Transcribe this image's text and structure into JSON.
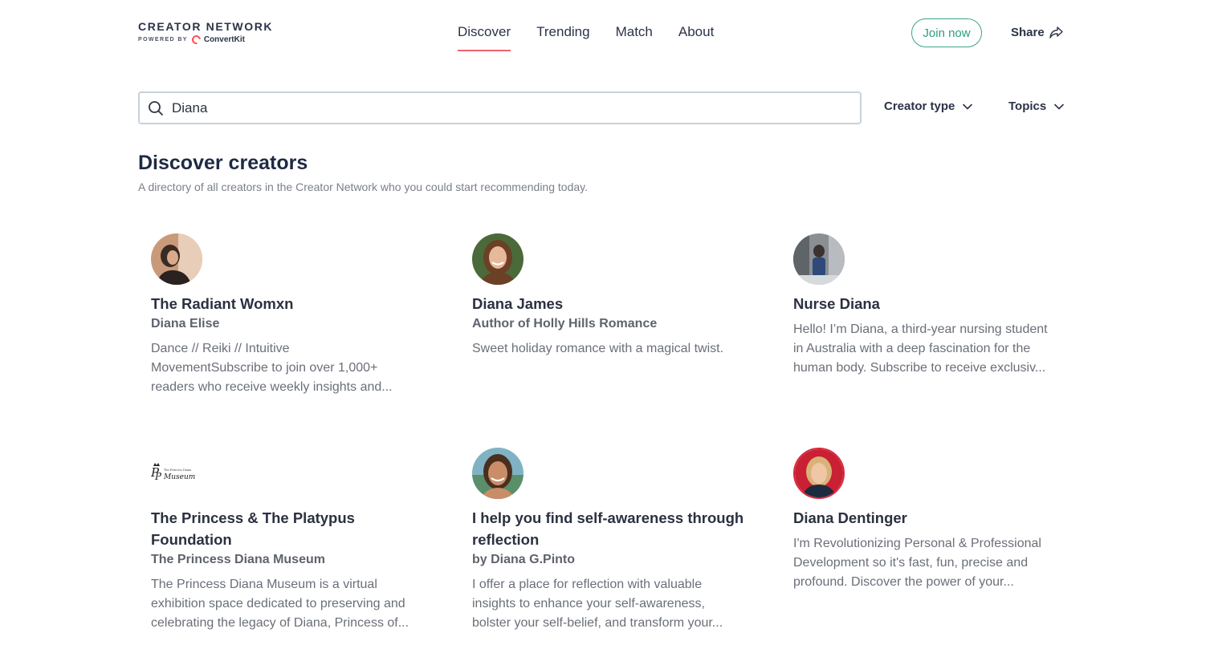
{
  "brand": {
    "title": "CREATOR NETWORK",
    "powered_by": "POWERED BY",
    "partner": "ConvertKit"
  },
  "nav": {
    "items": [
      {
        "label": "Discover",
        "active": true
      },
      {
        "label": "Trending",
        "active": false
      },
      {
        "label": "Match",
        "active": false
      },
      {
        "label": "About",
        "active": false
      }
    ]
  },
  "header": {
    "join_label": "Join now",
    "share_label": "Share"
  },
  "search": {
    "value": "Diana",
    "icon": "search-icon"
  },
  "filters": {
    "creator_type": "Creator type",
    "topics": "Topics"
  },
  "main": {
    "title": "Discover creators",
    "subtitle": "A directory of all creators in the Creator Network who you could start recommending today."
  },
  "cards": [
    {
      "title": "The Radiant Womxn",
      "subtitle": "Diana Elise",
      "description_lines": [
        "Dance // Reiki // Intuitive",
        "MovementSubscribe to join over 1,000+",
        "readers who receive weekly insights and..."
      ]
    },
    {
      "title": "Diana James",
      "subtitle": "Author of Holly Hills Romance",
      "description_lines": [
        "Sweet holiday romance with a magical twist."
      ]
    },
    {
      "title": "Nurse Diana",
      "subtitle": "",
      "description_lines": [
        "Hello! I’m Diana, a third-year nursing student",
        "in Australia with a deep fascination for the",
        "human body. Subscribe to receive exclusiv..."
      ]
    },
    {
      "title_lines": [
        "The Princess & The Platypus",
        "Foundation"
      ],
      "subtitle": "The Princess Diana Museum",
      "logo_text": "Museum",
      "logo_small": "The Princess Diana",
      "description_lines": [
        "The Princess Diana Museum is a virtual",
        "exhibition space dedicated to preserving and",
        "celebrating the legacy of Diana, Princess of..."
      ]
    },
    {
      "title_lines": [
        "I help you find self-awareness through",
        "reflection"
      ],
      "subtitle": "by Diana G.Pinto",
      "description_lines": [
        "I offer a place for reflection with valuable",
        "insights to enhance your self-awareness,",
        "bolster your self-belief, and transform your..."
      ]
    },
    {
      "title": "Diana Dentinger",
      "subtitle": "",
      "description_lines": [
        "I'm Revolutionizing Personal & Professional",
        "Development so it's fast, fun, precise and",
        "profound. Discover the power of your..."
      ]
    }
  ],
  "colors": {
    "accent_underline": "#f0646c",
    "join_border": "#3aa58a",
    "brand_red": "#ff4d4d"
  }
}
